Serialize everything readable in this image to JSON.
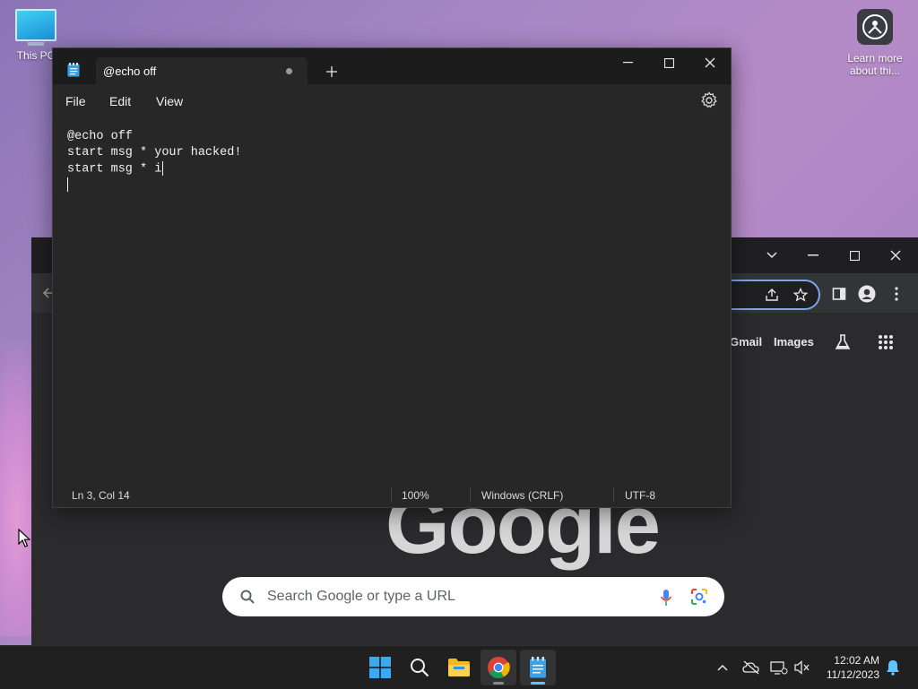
{
  "desktop": {
    "this_pc_label": "This PC",
    "learn_label_1": "Learn more",
    "learn_label_2": "about thi..."
  },
  "notepad": {
    "tab_title": "@echo off",
    "menu": {
      "file": "File",
      "edit": "Edit",
      "view": "View"
    },
    "lines": [
      "@echo off",
      "start msg * your hacked!",
      "start msg * i",
      ""
    ],
    "status": {
      "position": "Ln 3, Col 14",
      "zoom": "100%",
      "line_ending": "Windows (CRLF)",
      "encoding": "UTF-8"
    }
  },
  "chrome": {
    "gmail": "Gmail",
    "images": "Images",
    "logo_text": "Google",
    "search_placeholder": "Search Google or type a URL"
  },
  "taskbar": {
    "time": "12:02 AM",
    "date": "11/12/2023"
  },
  "colors": {
    "accent_blue": "#5fc7ff",
    "chrome_omnibox_border": "#7aa7e8"
  }
}
